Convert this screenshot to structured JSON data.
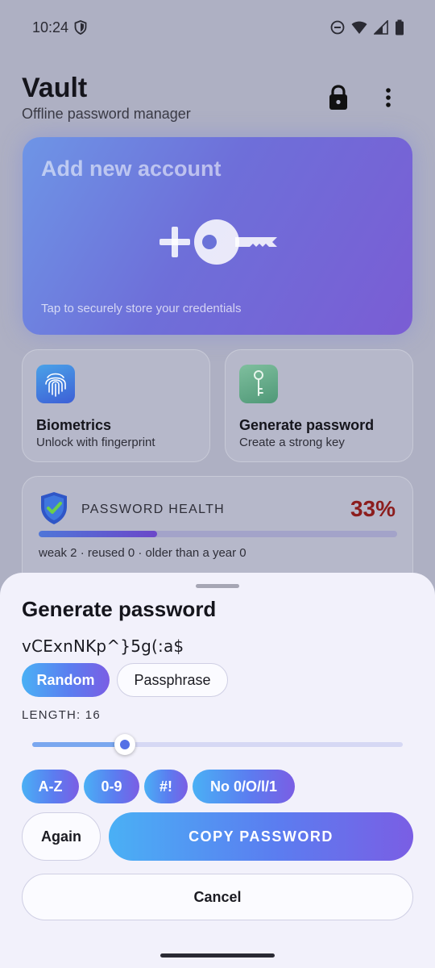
{
  "status_bar": {
    "time": "10:24",
    "icons": [
      "shield-icon",
      "do-not-disturb-icon",
      "wifi-icon",
      "signal-icon",
      "battery-icon"
    ]
  },
  "header": {
    "title": "Vault",
    "subtitle": "Offline password manager",
    "icons": [
      "lock-icon",
      "more-vert-icon"
    ]
  },
  "hero": {
    "title": "Add new account",
    "caption": "Tap to securely store your credentials",
    "icon": "plus-key-icon"
  },
  "features": [
    {
      "title": "Biometrics",
      "subtitle": "Unlock with fingerprint",
      "icon": "fingerprint-icon"
    },
    {
      "title": "Generate password",
      "subtitle": "Create a strong key",
      "icon": "key-icon"
    }
  ],
  "health": {
    "label": "PASSWORD HEALTH",
    "percent_label": "33%",
    "percent_value": 33,
    "stats": "weak 2 · reused 0 · older than a year 0",
    "icon": "shield-check-icon"
  },
  "sheet": {
    "title": "Generate password",
    "password": "vCExnNKp^}5g(:a$",
    "modes": [
      {
        "label": "Random",
        "selected": true
      },
      {
        "label": "Passphrase",
        "selected": false
      }
    ],
    "length_label": "LENGTH: 16",
    "length_value": 16,
    "slider_fraction": 0.25,
    "options": [
      "A-Z",
      "0-9",
      "#!",
      "No 0/O/l/1"
    ],
    "again_label": "Again",
    "copy_label": "COPY PASSWORD",
    "cancel_label": "Cancel"
  },
  "colors": {
    "accent_start": "#4ab0f5",
    "accent_end": "#7a5ee4",
    "health_percent": "#8c1d1d",
    "sheet_background": "#f2f1fb"
  }
}
